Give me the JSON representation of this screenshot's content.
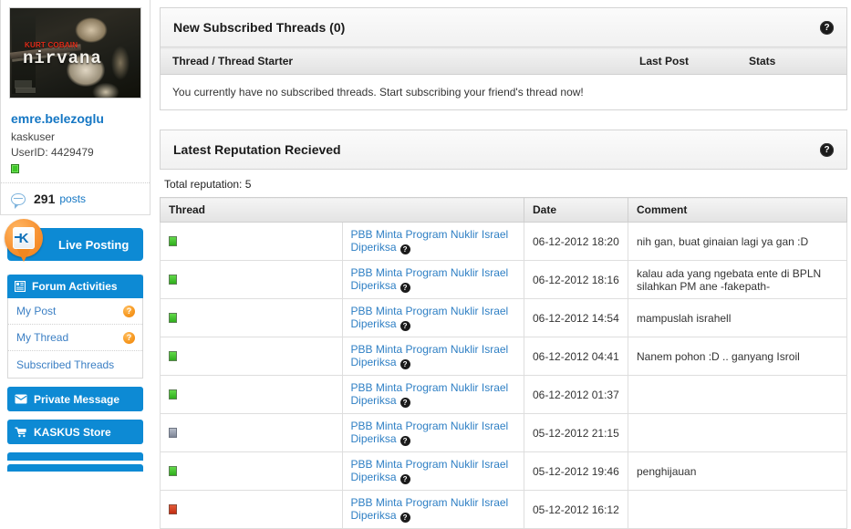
{
  "sidebar": {
    "avatar": {
      "alt": "Kurt Cobain Nirvana avatar",
      "artist_label": "KURT COBAIN",
      "band_label": "nirvana"
    },
    "username": "emre.belezoglu",
    "role": "kaskuser",
    "userid_label": "UserID: 4429479",
    "online_status": "online",
    "posts_count": "291",
    "posts_label": "posts",
    "live_posting": {
      "label": "Live Posting",
      "logo_letter": "K"
    },
    "forum_activities": {
      "header": "Forum Activities",
      "header_icon": "window-icon",
      "items": [
        {
          "label": "My Post",
          "badge": "?"
        },
        {
          "label": "My Thread",
          "badge": "?"
        },
        {
          "label": "Subscribed Threads",
          "badge": ""
        }
      ]
    },
    "private_message": {
      "label": "Private Message",
      "icon": "envelope-icon"
    },
    "kaskus_store": {
      "label": "KASKUS Store",
      "icon": "cart-icon"
    }
  },
  "subscribed_panel": {
    "title": "New Subscribed Threads (0)",
    "help_icon": "?",
    "columns": [
      "Thread / Thread Starter",
      "Last Post",
      "Stats"
    ],
    "empty_message": "You currently have no subscribed threads. Start subscribing your friend's thread now!"
  },
  "reputation_panel": {
    "title": "Latest Reputation Recieved",
    "help_icon": "?",
    "total_label": "Total reputation: 5",
    "columns": [
      "Thread",
      "Date",
      "Comment"
    ],
    "rows": [
      {
        "indicator": "green",
        "thread": "PBB Minta Program Nuklir Israel Diperiksa",
        "help": "?",
        "date": "06-12-2012 18:20",
        "comment": "nih gan, buat ginaian lagi ya gan :D"
      },
      {
        "indicator": "green",
        "thread": "PBB Minta Program Nuklir Israel Diperiksa",
        "help": "?",
        "date": "06-12-2012 18:16",
        "comment": "kalau ada yang ngebata ente di BPLN silahkan PM ane -fakepath-"
      },
      {
        "indicator": "green",
        "thread": "PBB Minta Program Nuklir Israel Diperiksa",
        "help": "?",
        "date": "06-12-2012 14:54",
        "comment": "mampuslah israhell"
      },
      {
        "indicator": "green",
        "thread": "PBB Minta Program Nuklir Israel Diperiksa",
        "help": "?",
        "date": "06-12-2012 04:41",
        "comment": "Nanem pohon :D .. ganyang Isroil"
      },
      {
        "indicator": "green",
        "thread": "PBB Minta Program Nuklir Israel Diperiksa",
        "help": "?",
        "date": "06-12-2012 01:37",
        "comment": ""
      },
      {
        "indicator": "gray",
        "thread": "PBB Minta Program Nuklir Israel Diperiksa",
        "help": "?",
        "date": "05-12-2012 21:15",
        "comment": ""
      },
      {
        "indicator": "green",
        "thread": "PBB Minta Program Nuklir Israel Diperiksa",
        "help": "?",
        "date": "05-12-2012 19:46",
        "comment": "penghijauan"
      },
      {
        "indicator": "red",
        "thread": "PBB Minta Program Nuklir Israel Diperiksa",
        "help": "?",
        "date": "05-12-2012 16:12",
        "comment": ""
      }
    ]
  },
  "colors": {
    "brand_blue": "#0d8ad4",
    "link_blue": "#2e7fc4",
    "badge_orange": "#f79a23",
    "status_green": "#3ec728",
    "status_red": "#c22d12",
    "status_gray": "#7e8697"
  }
}
